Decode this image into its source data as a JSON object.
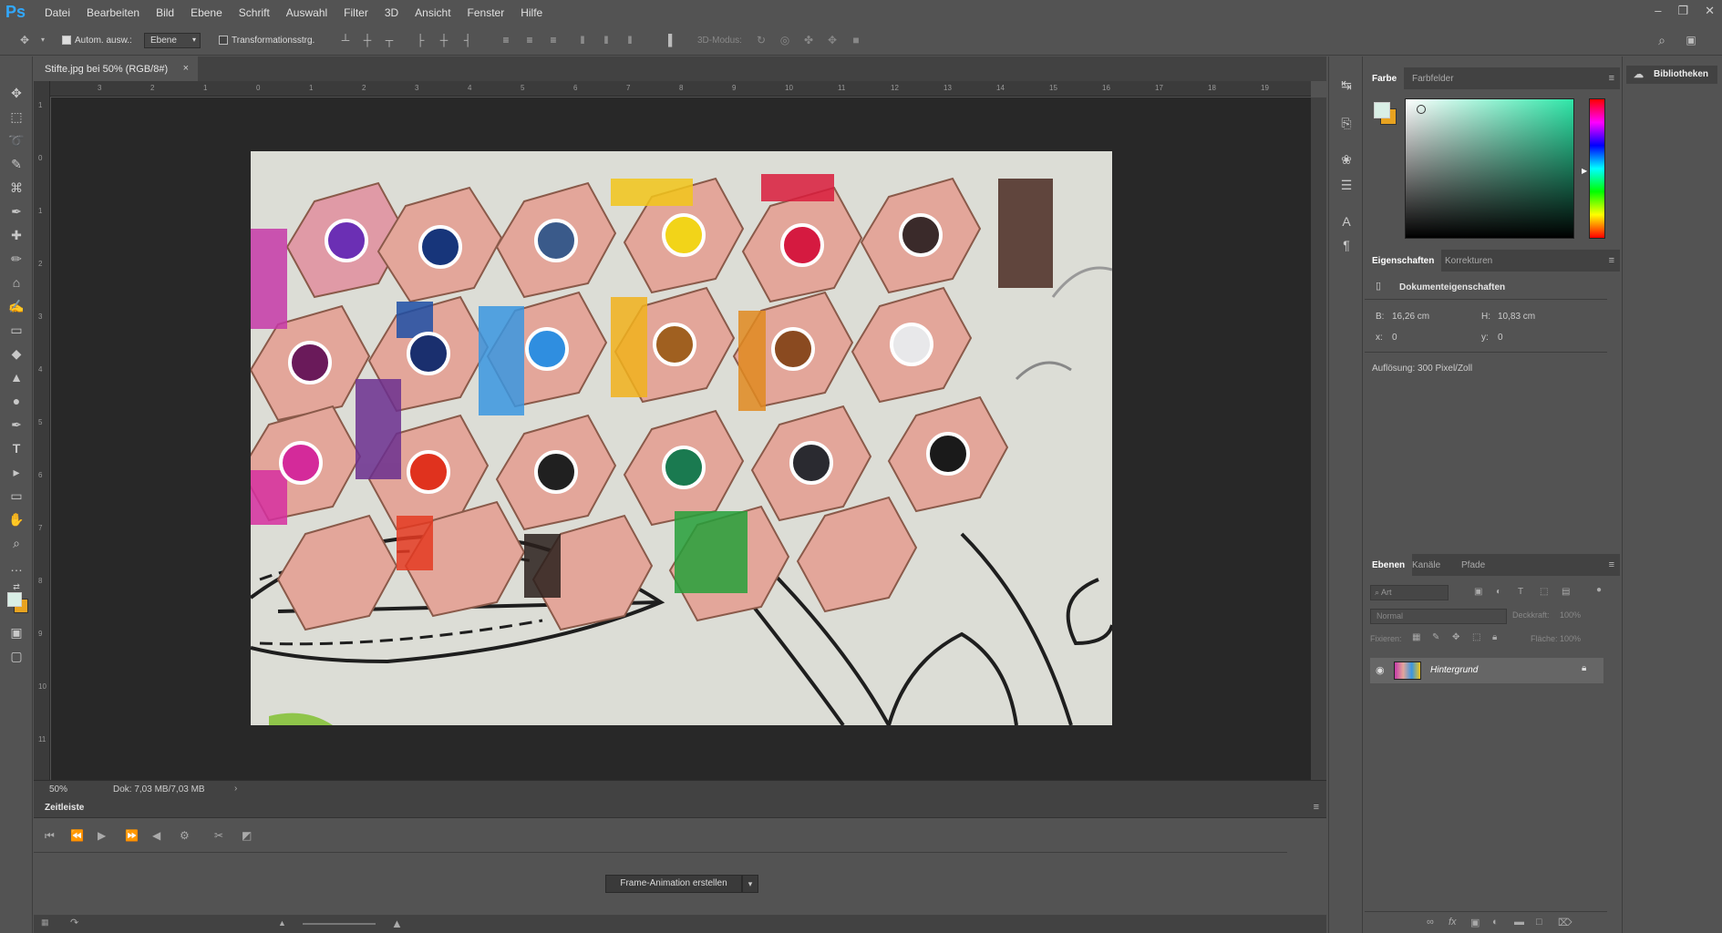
{
  "app": {
    "logo": "Ps"
  },
  "menu": [
    "Datei",
    "Bearbeiten",
    "Bild",
    "Ebene",
    "Schrift",
    "Auswahl",
    "Filter",
    "3D",
    "Ansicht",
    "Fenster",
    "Hilfe"
  ],
  "options": {
    "auto_select_label": "Autom. ausw.:",
    "auto_select_value": "Ebene",
    "transform_label": "Transformationsstrg.",
    "mode3d_label": "3D-Modus:"
  },
  "document": {
    "tab_title": "Stifte.jpg bei 50% (RGB/8#)",
    "close_glyph": "×",
    "zoom": "50%",
    "doc_size": "Dok: 7,03 MB/7,03 MB"
  },
  "rulers": {
    "top": [
      "3",
      "2",
      "1",
      "0",
      "1",
      "2",
      "3",
      "4",
      "5",
      "6",
      "7",
      "8",
      "9",
      "10",
      "11",
      "12",
      "13",
      "14",
      "15",
      "16",
      "17",
      "18",
      "19"
    ],
    "left": [
      "1",
      "0",
      "1",
      "2",
      "3",
      "4",
      "5",
      "6",
      "7",
      "8",
      "9",
      "10",
      "11"
    ]
  },
  "timeline": {
    "title": "Zeitleiste",
    "create_button": "Frame-Animation erstellen"
  },
  "color_panel": {
    "tabs": [
      "Farbe",
      "Farbfelder"
    ],
    "foreground": "#d9efe6",
    "background": "#e8a320",
    "field_hue": "#2fe6a8"
  },
  "properties_panel": {
    "tabs": [
      "Eigenschaften",
      "Korrekturen"
    ],
    "section": "Dokumenteigenschaften",
    "width_label": "B:",
    "width_value": "16,26 cm",
    "height_label": "H:",
    "height_value": "10,83 cm",
    "x_label": "x:",
    "x_value": "0",
    "y_label": "y:",
    "y_value": "0",
    "resolution": "Auflösung: 300 Pixel/Zoll"
  },
  "layers_panel": {
    "tabs": [
      "Ebenen",
      "Kanäle",
      "Pfade"
    ],
    "search_placeholder": "Art",
    "blend_mode": "Normal",
    "opacity_label": "Deckkraft:",
    "opacity_value": "100%",
    "lock_label": "Fixieren:",
    "fill_label": "Fläche:",
    "fill_value": "100%",
    "layer_name": "Hintergrund"
  },
  "libraries": {
    "label": "Bibliotheken"
  }
}
